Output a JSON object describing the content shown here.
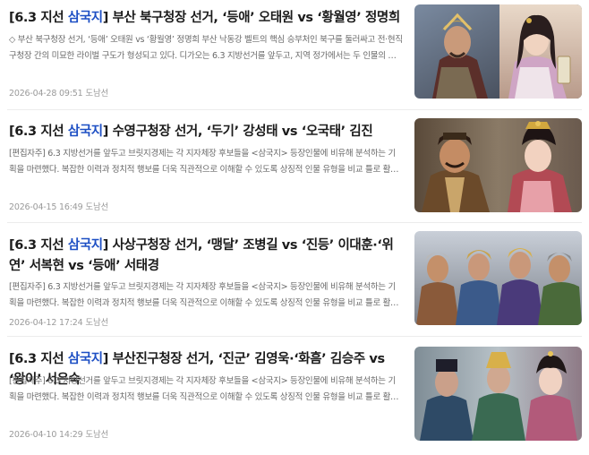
{
  "articles": [
    {
      "title_prefix": "[6.3 지선 ",
      "title_highlight": "삼국지",
      "title_suffix": "] 부산 북구청장 선거, ‘등애’ 오태원 vs ‘황월영’ 정명희",
      "summary": "◇ 부산 북구청장 선거, ‘등애’ 오태원 vs ‘황월영’ 정명희 부산 낙동강 벨트의 핵심 승부처인 북구를 둘러싸고 전·현직 구청장 간의 미묘한 라이벌 구도가 형성되고 있다. 디가오는 6.3 지방선거를 앞두고, 지역 정가에서는 두 인물의 행보를 두고 상반...",
      "date": "2026-04-28 09:51",
      "author": "도남선",
      "thumb_icon": "two-portraits-thumbnail"
    },
    {
      "title_prefix": "[6.3 지선 ",
      "title_highlight": "삼국지",
      "title_suffix": "] 수영구청장 선거, ‘두기’ 강성태 vs ‘오국태’ 김진",
      "summary": "[편집자주] 6.3 지방선거를 앞두고 브릿지경제는 각 지자체장 후보들을 <삼국지> 등장인물에 비유해 분석하는 기획을 마련했다. 복잡한 이력과 정치적 행보를 더욱 직관적으로 이해할 수 있도록 상징적 인물 유형을 비교 틀로 활용했다. 군주형, 책...",
      "date": "2026-04-15 16:49",
      "author": "도남선",
      "thumb_icon": "two-portraits-thumbnail"
    },
    {
      "title_prefix": "[6.3 지선 ",
      "title_highlight": "삼국지",
      "title_suffix": "] 사상구청장 선거, ‘맹달’ 조병길 vs ‘진등’ 이대훈·‘위연’ 서복현 vs ‘등애’ 서태경",
      "summary": "[편집자주] 6.3 지방선거를 앞두고 브릿지경제는 각 지자체장 후보들을 <삼국지> 등장인물에 비유해 분석하는 기획을 마련했다. 복잡한 이력과 정치적 행보를 더욱 직관적으로 이해할 수 있도록 상징적 인물 유형을 비교 틀로 활용했다. 군주형, 책...",
      "date": "2026-04-12 17:24",
      "author": "도남선",
      "thumb_icon": "four-warriors-thumbnail"
    },
    {
      "title_prefix": "[6.3 지선 ",
      "title_highlight": "삼국지",
      "title_suffix": "] 부산진구청장 선거, ‘진군’ 김영욱·‘화흠’ 김승주 vs ‘왕이’ 서은숙",
      "summary": "[편집자주] 6.3 지방선거를 앞두고 브릿지경제는 각 지자체장 후보들을 <삼국지> 등장인물에 비유해 분석하는 기획을 마련했다. 복잡한 이력과 정치적 행보를 더욱 직관적으로 이해할 수 있도록 상징적 인물 유형을 비교 틀로 활용했다. 군주형, 책...",
      "date": "2026-04-10 14:29",
      "author": "도남선",
      "thumb_icon": "three-figures-thumbnail"
    }
  ],
  "colors": {
    "title_highlight": "#1d4fc4",
    "title_text": "#1b1b1b",
    "summary_text": "#6a6a6a",
    "meta_text": "#9a9a9a",
    "divider": "#ececec"
  }
}
